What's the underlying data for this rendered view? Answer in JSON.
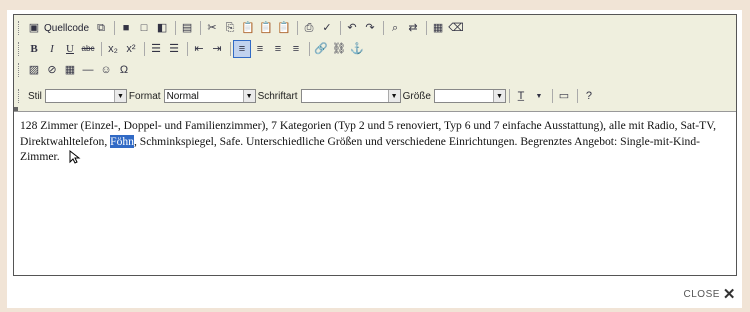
{
  "toolbar": {
    "source_label": "Quellcode",
    "style_label": "Stil",
    "style_value": "",
    "format_label": "Format",
    "format_value": "Normal",
    "font_label": "Schriftart",
    "font_value": "",
    "size_label": "Größe",
    "size_value": ""
  },
  "content": {
    "text_before": "128 Zimmer (Einzel-, Doppel- und Familienzimmer), 7 Kategorien (Typ 2 und 5 renoviert, Typ 6 und 7 einfache Ausstattung), alle mit Radio, Sat-TV, Direktwahltelefon, ",
    "highlighted": "Föhn",
    "text_after": ", Schminkspiegel, Safe. Unterschiedliche Größen und verschiedene Einrichtungen. Begrenztes Angebot: Single-mit-Kind-Zimmer."
  },
  "close": {
    "label": "CLOSE"
  }
}
